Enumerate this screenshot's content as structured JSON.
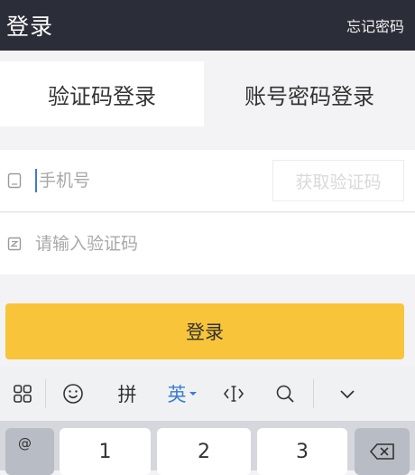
{
  "header": {
    "title": "登录",
    "forgot_password": "忘记密码"
  },
  "tabs": [
    {
      "label": "验证码登录",
      "active": true
    },
    {
      "label": "账号密码登录",
      "active": false
    }
  ],
  "form": {
    "phone_placeholder": "手机号",
    "phone_value": "",
    "get_code_label": "获取验证码",
    "code_placeholder": "请输入验证码",
    "code_value": ""
  },
  "login_button": "登录",
  "keyboard": {
    "toolbar": {
      "grid": "grid-icon",
      "emoji": "emoji-icon",
      "pinyin": "拼",
      "english": "英",
      "cursor": "cursor-move-icon",
      "search": "search-icon",
      "collapse": "chevron-down-icon"
    },
    "keys": {
      "symbol": "@",
      "k1": "1",
      "k2": "2",
      "k3": "3",
      "backspace": "backspace-icon"
    }
  },
  "colors": {
    "topbar": "#2b2e38",
    "accent_button": "#f8c43a",
    "active_blue": "#3a7bd5"
  }
}
